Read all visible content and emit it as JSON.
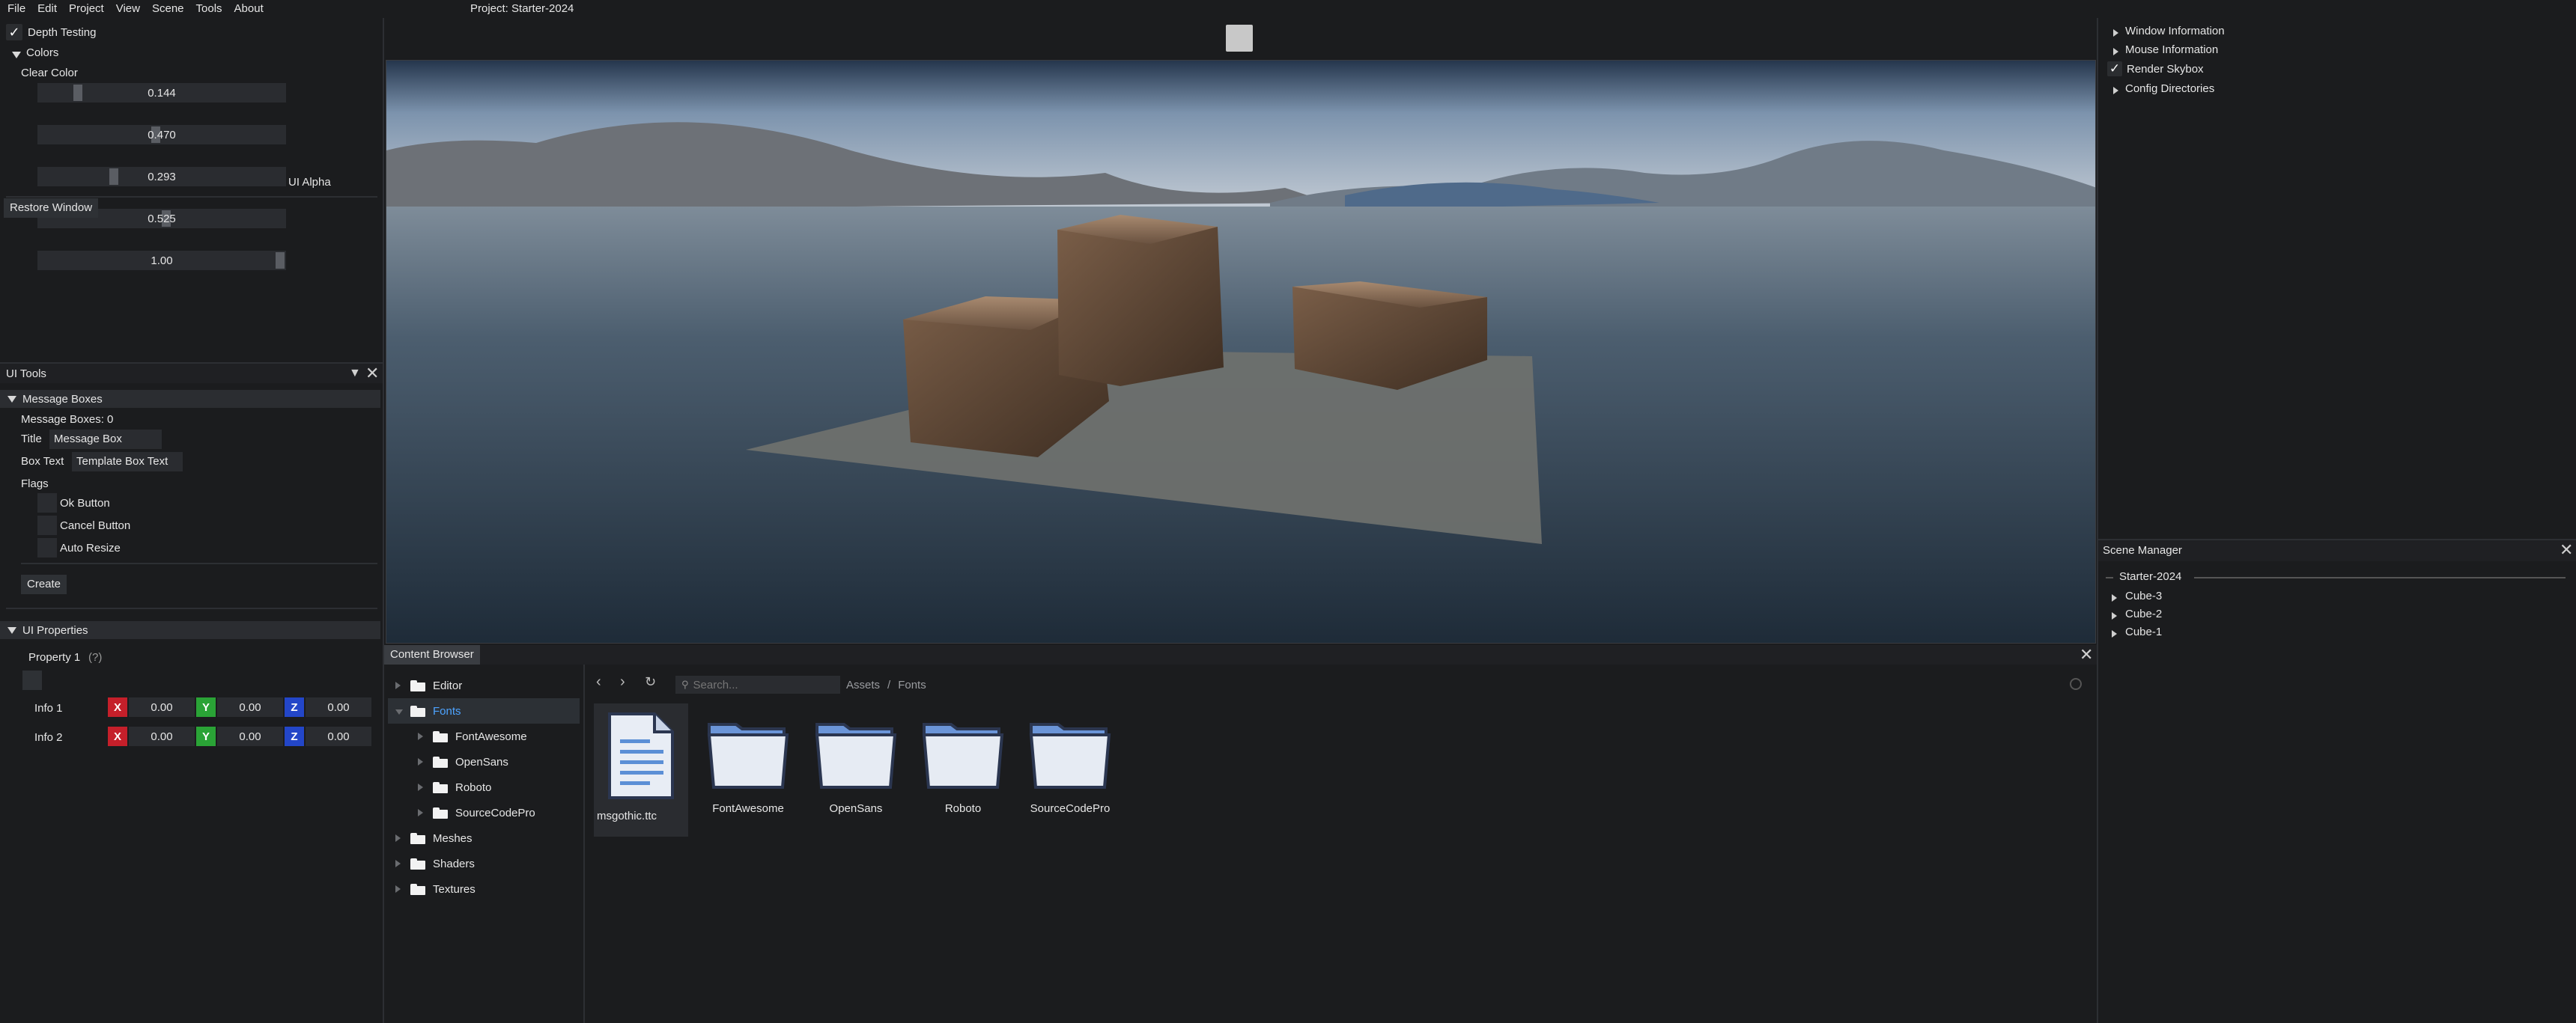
{
  "menubar": {
    "items": [
      "File",
      "Edit",
      "Project",
      "View",
      "Scene",
      "Tools",
      "About"
    ],
    "project_title": "Project: Starter-2024"
  },
  "settings_panel": {
    "depth_testing": "Depth Testing",
    "colors_header": "Colors",
    "clear_color_label": "Clear Color",
    "clear_color_values": [
      "0.144",
      "0.470",
      "0.293",
      "0.525"
    ],
    "ui_alpha_value": "1.00",
    "ui_alpha_label": "UI Alpha",
    "restore_window": "Restore Window"
  },
  "ui_tools": {
    "title": "UI Tools",
    "message_boxes_header": "Message Boxes",
    "message_boxes_count": "Message Boxes: 0",
    "title_label": "Title",
    "title_value": "Message Box",
    "box_text_label": "Box Text",
    "box_text_value": "Template Box Text",
    "flags_label": "Flags",
    "flags": [
      "Ok Button",
      "Cancel Button",
      "Auto Resize"
    ],
    "create_button": "Create",
    "ui_properties_header": "UI Properties",
    "property1_label": "Property 1",
    "property1_help": "(?)",
    "info_rows": [
      {
        "label": "Info 1",
        "x": "0.00",
        "y": "0.00",
        "z": "0.00"
      },
      {
        "label": "Info 2",
        "x": "0.00",
        "y": "0.00",
        "z": "0.00"
      }
    ],
    "axis_labels": {
      "x": "X",
      "y": "Y",
      "z": "Z"
    }
  },
  "right_panel": {
    "items": [
      "Window Information",
      "Mouse Information",
      "Render Skybox",
      "Config Directories"
    ]
  },
  "scene_manager": {
    "title": "Scene Manager",
    "scene_name": "Starter-2024",
    "entities": [
      "Cube-3",
      "Cube-2",
      "Cube-1"
    ]
  },
  "content_browser": {
    "title": "Content Browser",
    "search_placeholder": "Search...",
    "breadcrumb": [
      "Assets",
      "/",
      "Fonts"
    ],
    "tree": {
      "editor": "Editor",
      "fonts": "Fonts",
      "fonts_children": [
        "FontAwesome",
        "OpenSans",
        "Roboto",
        "SourceCodePro"
      ],
      "meshes": "Meshes",
      "shaders": "Shaders",
      "textures": "Textures"
    },
    "assets": [
      "msgothic.ttc",
      "FontAwesome",
      "OpenSans",
      "Roboto",
      "SourceCodePro"
    ]
  },
  "colors": {
    "accent_blue": "#4da3ff",
    "axis_x": "#c51f2a",
    "axis_y": "#2aa336",
    "axis_z": "#2346c8"
  }
}
